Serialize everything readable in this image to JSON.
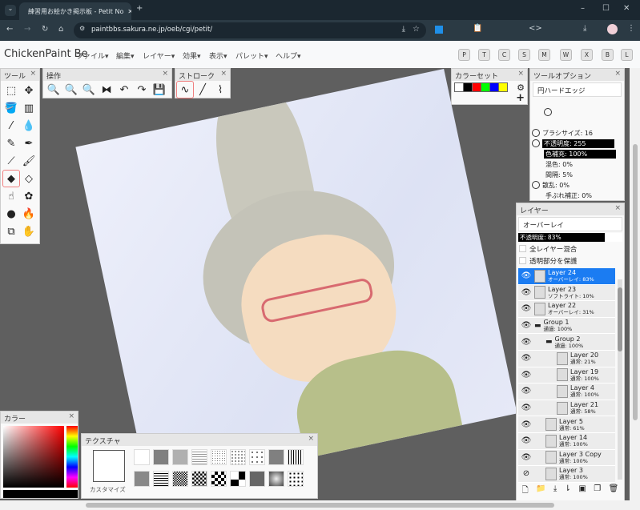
{
  "browser": {
    "tab_title": "練習用お絵かき掲示板 - Petit No",
    "url": "paintbbs.sakura.ne.jp/oeb/cgi/petit/"
  },
  "app": {
    "title": "ChickenPaint Be",
    "menus": [
      "ファイル▾",
      "編集▾",
      "レイヤー▾",
      "効果▾",
      "表示▾",
      "パレット▾",
      "ヘルプ▾"
    ],
    "palette_buttons": [
      "P",
      "T",
      "C",
      "S",
      "M",
      "W",
      "X",
      "B",
      "L"
    ]
  },
  "panels": {
    "tools": {
      "title": "ツール",
      "close": "×"
    },
    "operations": {
      "title": "操作",
      "close": "×"
    },
    "stroke": {
      "title": "ストローク",
      "close": "×"
    },
    "colorset": {
      "title": "カラーセット",
      "close": "×",
      "swatches": [
        "#ffffff",
        "#000000",
        "#ff0000",
        "#00ff00",
        "#0000ff",
        "#ffff00"
      ]
    },
    "tool_options": {
      "title": "ツールオプション",
      "close": "×",
      "brush_tip": "円ハードエッジ",
      "brush_size": "ブラシサイズ: 16",
      "opacity": "不透明度: 255",
      "color_fill": "色補充: 100%",
      "mix": "混色: 0%",
      "spacing": "間隔: 5%",
      "scatter": "散乱: 0%",
      "smoothing": "手ぶれ補正: 0%"
    },
    "layers": {
      "title": "レイヤー",
      "close": "×",
      "blend_mode": "オーバーレイ",
      "opacity": "不透明度: 83%",
      "opacity_value": 83,
      "sample_all": "全レイヤー混合",
      "lock_alpha": "透明部分を保護",
      "items": [
        {
          "name": "Layer 24",
          "mode": "オーバーレイ: 83%",
          "active": true
        },
        {
          "name": "Layer 23",
          "mode": "ソフトライト: 10%"
        },
        {
          "name": "Layer 22",
          "mode": "オーバーレイ: 31%"
        },
        {
          "name": "Group 1",
          "mode": "通過: 100%"
        },
        {
          "name": "Group 2",
          "mode": "通過: 100%"
        },
        {
          "name": "Layer 20",
          "mode": "通常: 21%"
        },
        {
          "name": "Layer 19",
          "mode": "通常: 100%"
        },
        {
          "name": "Layer 4",
          "mode": "通常: 100%"
        },
        {
          "name": "Layer 21",
          "mode": "通常: 58%"
        },
        {
          "name": "Layer 5",
          "mode": "通常: 61%"
        },
        {
          "name": "Layer 14",
          "mode": "通常: 100%"
        },
        {
          "name": "Layer 3 Copy",
          "mode": "通常: 100%"
        },
        {
          "name": "Layer 3",
          "mode": "通常: 100%",
          "hidden": true
        }
      ]
    },
    "color": {
      "title": "カラー",
      "close": "×",
      "current": "#000000"
    },
    "texture": {
      "title": "テクスチャ",
      "close": "×",
      "customize": "カスタマイズ"
    }
  }
}
